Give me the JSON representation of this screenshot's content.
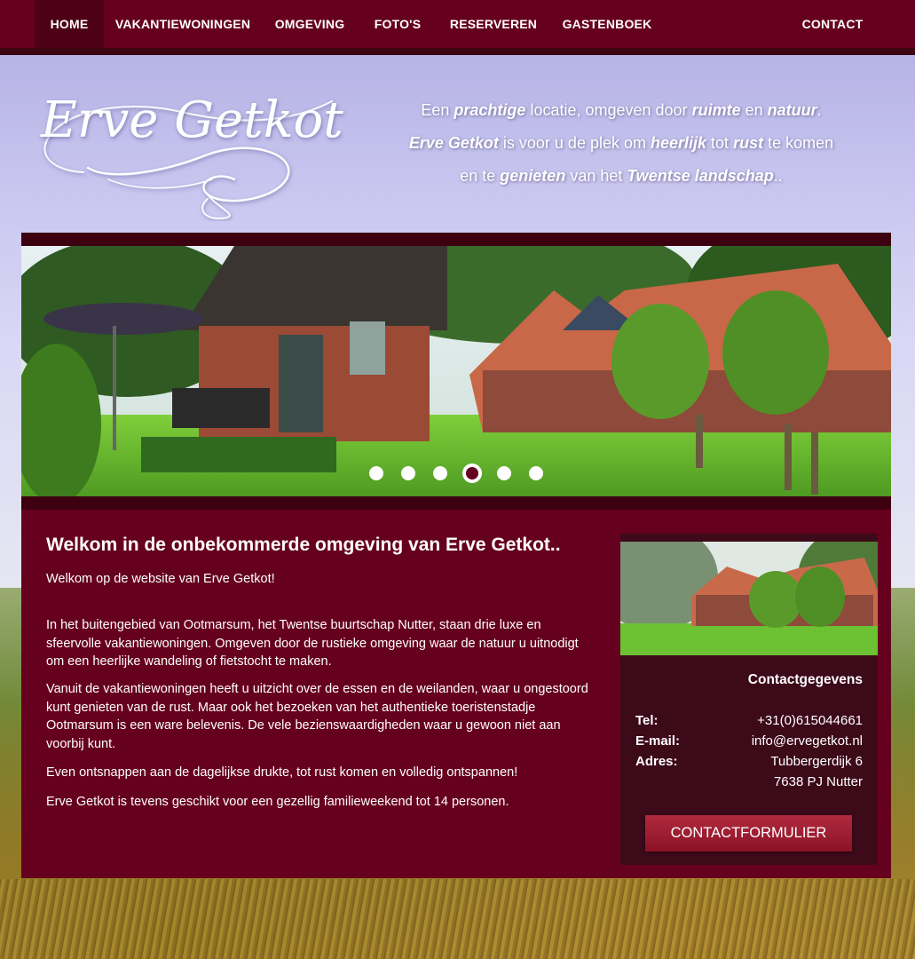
{
  "nav": {
    "items": [
      {
        "label": "HOME",
        "active": true
      },
      {
        "label": "VAKANTIEWONINGEN"
      },
      {
        "label": "OMGEVING"
      },
      {
        "label": "FOTO'S"
      },
      {
        "label": "RESERVEREN"
      },
      {
        "label": "GASTENBOEK"
      },
      {
        "label": "CONTACT"
      }
    ]
  },
  "header": {
    "logo_text": "Erve Getkot",
    "tagline": {
      "line1": [
        {
          "t": "Een ",
          "em": false
        },
        {
          "t": "prachtige",
          "em": true
        },
        {
          "t": " locatie, omgeven door ",
          "em": false
        },
        {
          "t": "ruimte",
          "em": true
        },
        {
          "t": " en ",
          "em": false
        },
        {
          "t": "natuur",
          "em": true
        },
        {
          "t": ".",
          "em": false
        }
      ],
      "line2": [
        {
          "t": "Erve Getkot",
          "em": true
        },
        {
          "t": " is voor u de plek om ",
          "em": false
        },
        {
          "t": "heerlijk",
          "em": true
        },
        {
          "t": " tot ",
          "em": false
        },
        {
          "t": "rust",
          "em": true
        },
        {
          "t": " te komen",
          "em": false
        }
      ],
      "line3": [
        {
          "t": "en te ",
          "em": false
        },
        {
          "t": "genieten",
          "em": true
        },
        {
          "t": " van het ",
          "em": false
        },
        {
          "t": "Twentse landschap",
          "em": true
        },
        {
          "t": "..",
          "em": false
        }
      ]
    }
  },
  "slider": {
    "slide_count": 6,
    "active_slide": 4
  },
  "main": {
    "title": "Welkom in de onbekommerde omgeving van Erve Getkot..",
    "intro": "Welkom op de website van Erve Getkot!",
    "paragraphs": [
      "In het buitengebied van Ootmarsum, het Twentse buurtschap Nutter, staan drie luxe en sfeervolle vakantiewoningen. Omgeven door de rustieke omgeving waar de natuur u uitnodigt om een heerlijke wandeling of fietstocht te maken.",
      "Vanuit de vakantiewoningen heeft u uitzicht over de essen en de weilanden, waar u ongestoord kunt genieten van de rust. Maar ook het bezoeken van het authentieke toeristenstadje Ootmarsum is een ware belevenis. De vele bezienswaardigheden waar u gewoon niet aan voorbij kunt.",
      "Even ontsnappen aan de dagelijkse drukte, tot rust komen en volledig ontspannen!",
      "Erve Getkot is tevens geschikt voor een gezellig familieweekend tot 14 personen."
    ]
  },
  "contact": {
    "heading": "Contactgegevens",
    "tel_label": "Tel:",
    "tel": "+31(0)615044661",
    "email_label": "E-mail:",
    "email": "info@ervegetkot.nl",
    "address_label": "Adres:",
    "address_line1": "Tubbergerdijk 6",
    "address_line2": "7638 PJ Nutter",
    "button": "CONTACTFORMULIER"
  },
  "colors": {
    "brand": "#66001f",
    "brand_dark": "#3d0010",
    "button": "#a01e34"
  }
}
